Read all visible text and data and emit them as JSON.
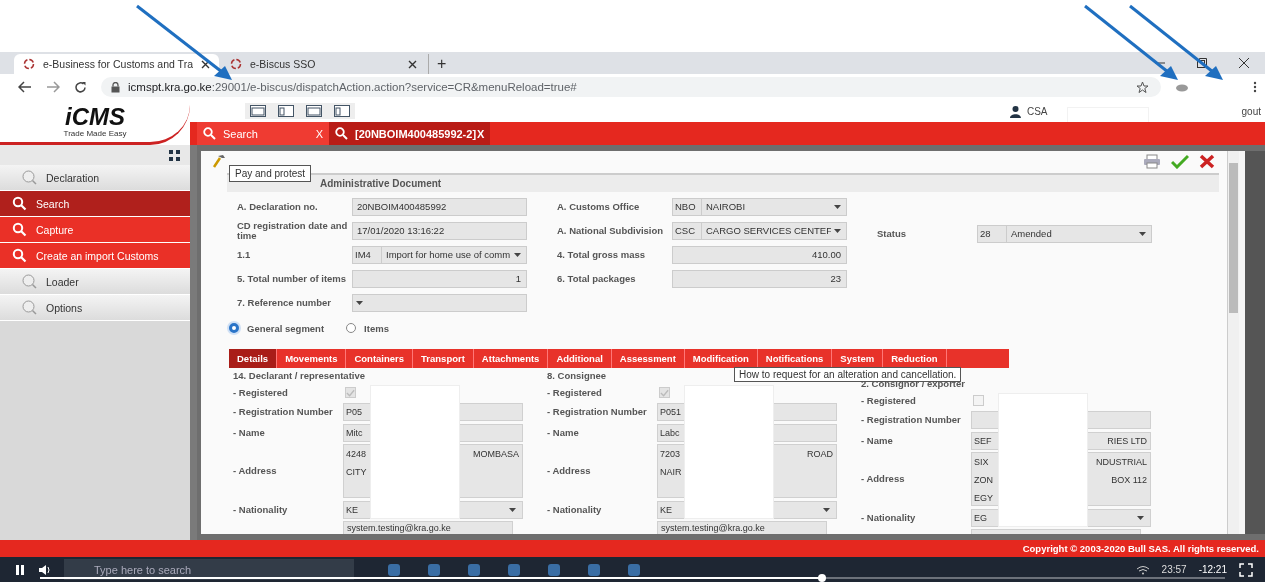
{
  "browser": {
    "tabs": [
      {
        "title": "e-Business for Customs and Tra",
        "selected": true
      },
      {
        "title": "e-Biscus SSO",
        "selected": false
      }
    ],
    "new_tab": "+",
    "url_host": "icmspt.kra.go.ke",
    "url_rest": ":29001/e-biscus/dispatchAction.action?service=CR&menuReload=true#"
  },
  "header": {
    "logo": "iCMS",
    "logo_tagline": "Trade Made Easy",
    "user": "CSA",
    "logout": "gout",
    "tabs": [
      {
        "label": "Search",
        "close": "X",
        "selected": false
      },
      {
        "label": "[20NBOIM400485992-2]",
        "close": "X",
        "selected": true
      }
    ]
  },
  "sidebar": {
    "items": [
      {
        "label": "Declaration",
        "kind": "plain",
        "selected": false
      },
      {
        "label": "Search",
        "kind": "action",
        "selected": true
      },
      {
        "label": "Capture",
        "kind": "action",
        "selected": false
      },
      {
        "label": "Create an import Customs",
        "kind": "action",
        "selected": false
      },
      {
        "label": "Loader",
        "kind": "plain",
        "selected": false
      },
      {
        "label": "Options",
        "kind": "plain",
        "selected": false
      }
    ]
  },
  "form": {
    "tooltip": "Pay and protest",
    "section_title": "Administrative Document",
    "left_fields": [
      {
        "label": "A. Declaration no.",
        "kind": "text",
        "value": "20NBOIM400485992"
      },
      {
        "label": "CD registration date and time",
        "kind": "text",
        "value": "17/01/2020 13:16:22"
      },
      {
        "label": "1.1",
        "kind": "select",
        "code": "IM4",
        "value": "Import for home use of comm"
      },
      {
        "label": "5. Total number of items",
        "kind": "number",
        "value": "1"
      },
      {
        "label": "7. Reference number",
        "kind": "select"
      }
    ],
    "mid_fields": [
      {
        "label": "A. Customs Office",
        "kind": "select",
        "code": "NBO",
        "value": "NAIROBI"
      },
      {
        "label": "A. National Subdivision",
        "kind": "select",
        "code": "CSC",
        "value": "CARGO SERVICES CENTEF"
      },
      {
        "label": "4. Total gross mass",
        "kind": "number",
        "value": "410.00"
      },
      {
        "label": "6. Total packages",
        "kind": "number",
        "value": "23"
      }
    ],
    "status": {
      "label": "Status",
      "kind": "select",
      "code": "28",
      "value": "Amended"
    },
    "radios": [
      {
        "label": "General segment",
        "selected": true
      },
      {
        "label": "Items",
        "selected": false
      }
    ]
  },
  "detail_tabs": [
    {
      "label": "Details",
      "selected": true
    },
    {
      "label": "Movements",
      "selected": false
    },
    {
      "label": "Containers",
      "selected": false
    },
    {
      "label": "Transport",
      "selected": false
    },
    {
      "label": "Attachments",
      "selected": false
    },
    {
      "label": "Additional",
      "selected": false
    },
    {
      "label": "Assessment",
      "selected": false
    },
    {
      "label": "Modification",
      "selected": false
    },
    {
      "label": "Notifications",
      "selected": false
    },
    {
      "label": "System",
      "selected": false
    },
    {
      "label": "Reduction",
      "selected": false
    }
  ],
  "tabs_tooltip": "How to request for an alteration and cancellation.",
  "parties": [
    {
      "title": "14. Declarant / representative",
      "registered_label": "- Registered",
      "registered": true,
      "reg_label": "- Registration Number",
      "reg_value": "P05",
      "name_label": "- Name",
      "name_start": "Mitc",
      "address_label": "- Address",
      "address_start": [
        "4248",
        "CITY"
      ],
      "address_end": [
        "MOMBASA"
      ],
      "nationality_label": "- Nationality",
      "nationality": "KE",
      "email": "system.testing@kra.go.ke"
    },
    {
      "title": "8. Consignee",
      "registered_label": "- Registered",
      "registered": true,
      "reg_label": "- Registration Number",
      "reg_value": "P051",
      "name_label": "- Name",
      "name_start": "Labc",
      "address_label": "- Address",
      "address_start": [
        "7203",
        "NAIR"
      ],
      "address_end": [
        "ROAD"
      ],
      "nationality_label": "- Nationality",
      "nationality": "KE",
      "email": "system.testing@kra.go.ke"
    },
    {
      "title": "2. Consignor / exporter",
      "registered_label": "- Registered",
      "registered": false,
      "reg_label": "- Registration Number",
      "name_label": "- Name",
      "name_start": "SEF",
      "name_end": "RIES LTD",
      "address_label": "- Address",
      "address_start": [
        "SIX",
        "ZON",
        "EGY"
      ],
      "address_end": [
        "NDUSTRIAL",
        "BOX 112"
      ],
      "nationality_label": "- Nationality",
      "nationality": "EG"
    }
  ],
  "footer": "Copyright © 2003-2020 Bull SAS. All rights reserved.",
  "taskbar": {
    "search_placeholder": "Type here to search",
    "clock": "23:57",
    "video_time": "-12:21",
    "level": 0.66
  }
}
